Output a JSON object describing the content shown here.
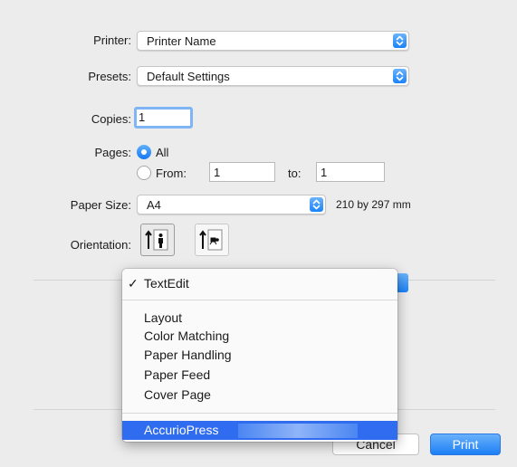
{
  "printer": {
    "label": "Printer:",
    "value": "Printer Name"
  },
  "presets": {
    "label": "Presets:",
    "value": "Default Settings"
  },
  "copies": {
    "label": "Copies:",
    "value": "1"
  },
  "pages": {
    "label": "Pages:",
    "all_label": "All",
    "from_label": "From:",
    "from_value": "1",
    "to_label": "to:",
    "to_value": "1"
  },
  "paper_size": {
    "label": "Paper Size:",
    "value": "A4",
    "dimensions": "210 by 297 mm"
  },
  "orientation": {
    "label": "Orientation:",
    "portrait_icon": "portrait-orientation-icon",
    "landscape_icon": "landscape-orientation-icon"
  },
  "menu": {
    "checked_item": "TextEdit",
    "items": [
      "Layout",
      "Color Matching",
      "Paper Handling",
      "Paper Feed",
      "Cover Page"
    ],
    "highlighted_item": "AccurioPress"
  },
  "buttons": {
    "cancel": "Cancel",
    "print": "Print"
  },
  "colors": {
    "accent": "#1c7ff5",
    "highlight": "#2f6cf0",
    "background": "#ececec"
  }
}
